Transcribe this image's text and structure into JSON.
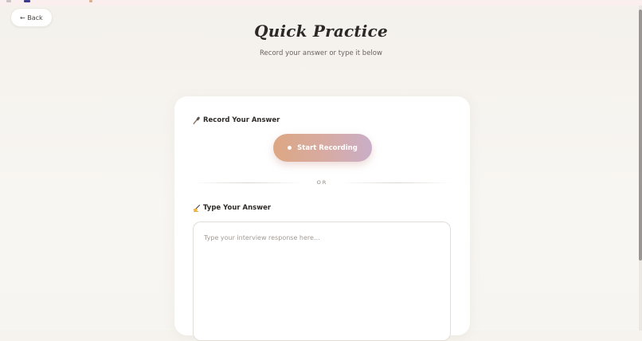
{
  "page": {
    "title": "Quick Practice",
    "subtitle": "Record your answer or type it below"
  },
  "nav": {
    "back_label": "← Back"
  },
  "record_section": {
    "label": "Record Your Answer",
    "icon": "microphone-icon",
    "button_label": "Start Recording"
  },
  "divider": {
    "text": "OR"
  },
  "type_section": {
    "label": "Type Your Answer",
    "icon": "writing-hand-icon",
    "placeholder": "Type your interview response here...",
    "value": ""
  },
  "colors": {
    "background": "#f6f3ee",
    "card": "#ffffff",
    "button_gradient_start": "#dda784",
    "button_gradient_end": "#c9aec8",
    "title": "#2c2826"
  }
}
